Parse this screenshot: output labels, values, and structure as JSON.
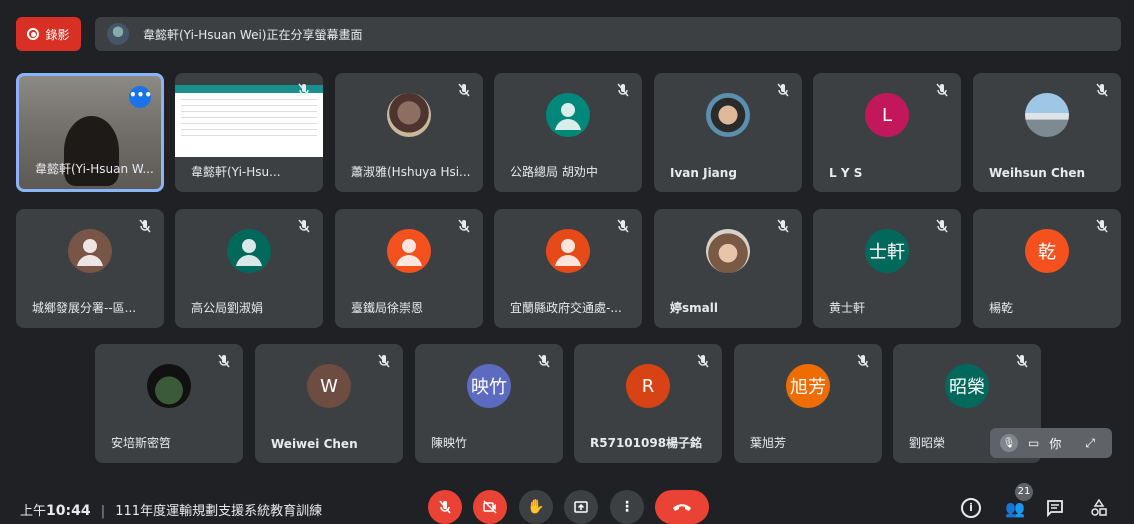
{
  "topbar": {
    "record_label": "錄影",
    "share_text": "韋懿軒(Yi-Hsuan Wei)正在分享螢幕畫面"
  },
  "tiles": [
    {
      "name": "韋懿軒(Yi-Hsuan W...",
      "type": "video-self"
    },
    {
      "name": "韋懿軒(Yi-Hsu...",
      "type": "screenshare"
    },
    {
      "name": "蕭淑雅(Hshuya Hsi...",
      "type": "photo-bear"
    },
    {
      "name": "公路總局 胡劝中",
      "type": "person",
      "color": "#00897b"
    },
    {
      "name": "Ivan Jiang",
      "type": "photo-man",
      "bold": true
    },
    {
      "name": "L Y S",
      "type": "letter",
      "letter": "L",
      "color": "#c2185b",
      "bold": true
    },
    {
      "name": "Weihsun Chen",
      "type": "photo-landscape",
      "bold": true
    },
    {
      "name": "城鄉發展分署--區...",
      "type": "person",
      "color": "#795548"
    },
    {
      "name": "高公局劉淑娟",
      "type": "person",
      "color": "#00695c"
    },
    {
      "name": "臺鐵局徐崇恩",
      "type": "person",
      "color": "#f4511e"
    },
    {
      "name": "宜蘭縣政府交通處-...",
      "type": "person",
      "color": "#e64a19"
    },
    {
      "name": "婷small",
      "type": "photo-woman",
      "bold": true
    },
    {
      "name": "黄士軒",
      "type": "letter",
      "letter": "士軒",
      "color": "#00695c"
    },
    {
      "name": "楊乾",
      "type": "letter",
      "letter": "乾",
      "color": "#f4511e"
    },
    {
      "name": "安培斯密笤",
      "type": "photo-night"
    },
    {
      "name": "Weiwei Chen",
      "type": "letter",
      "letter": "W",
      "color": "#6d4c41",
      "bold": true
    },
    {
      "name": "陳映竹",
      "type": "letter",
      "letter": "映竹",
      "color": "#5c6bc0"
    },
    {
      "name": "R57101098楊子銘",
      "type": "letter",
      "letter": "R",
      "color": "#d84315",
      "bold": true
    },
    {
      "name": "葉旭芳",
      "type": "letter",
      "letter": "旭芳",
      "color": "#ef6c00"
    },
    {
      "name": "劉昭榮",
      "type": "letter",
      "letter": "昭榮",
      "color": "#00695c"
    }
  ],
  "self_pill": {
    "label": "你"
  },
  "bottombar": {
    "time_prefix": "上午",
    "time": "10:44",
    "separator": "|",
    "meeting_title": "111年度運輸規劃支援系統教育訓練",
    "participant_count": "21"
  }
}
